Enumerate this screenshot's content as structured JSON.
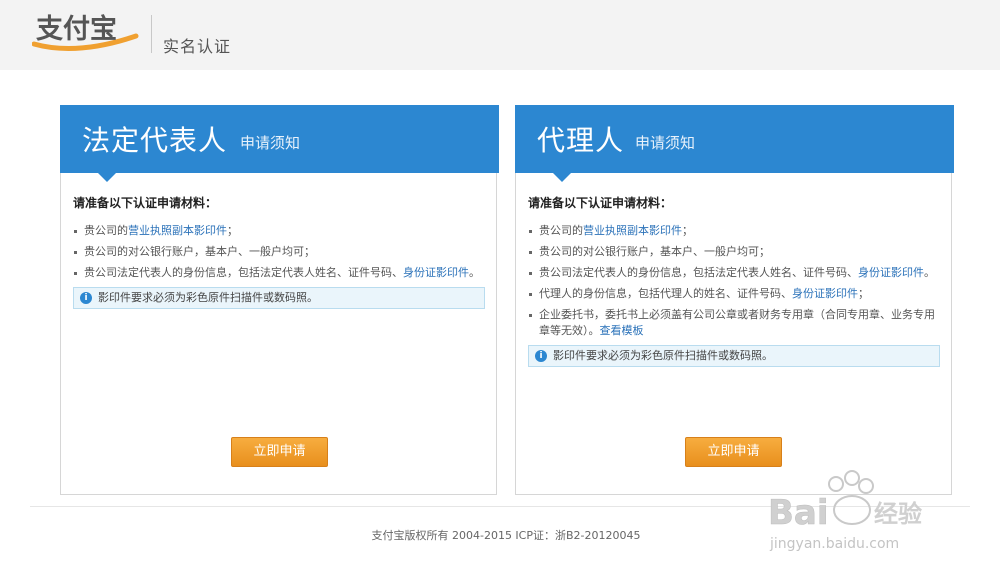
{
  "header": {
    "logo_text": "支付宝",
    "title": "实名认证"
  },
  "cards": [
    {
      "title": "法定代表人",
      "subtitle": "申请须知",
      "lead": "请准备以下认证申请材料：",
      "items": [
        {
          "text": "贵公司的",
          "link": "营业执照副本影印件",
          "tail": "；"
        },
        {
          "text": "贵公司的对公银行账户，基本户、一般户均可；",
          "link": "",
          "tail": ""
        },
        {
          "text": "贵公司法定代表人的身份信息，包括法定代表人姓名、证件号码、",
          "link": "身份证影印件",
          "tail": "。"
        }
      ],
      "notice": "影印件要求必须为彩色原件扫描件或数码照。",
      "button": "立即申请"
    },
    {
      "title": "代理人",
      "subtitle": "申请须知",
      "lead": "请准备以下认证申请材料：",
      "items": [
        {
          "text": "贵公司的",
          "link": "营业执照副本影印件",
          "tail": "；"
        },
        {
          "text": "贵公司的对公银行账户，基本户、一般户均可；",
          "link": "",
          "tail": ""
        },
        {
          "text": "贵公司法定代表人的身份信息，包括法定代表人姓名、证件号码、",
          "link": "身份证影印件",
          "tail": "。"
        },
        {
          "text": "代理人的身份信息，包括代理人的姓名、证件号码、",
          "link": "身份证影印件",
          "tail": "；"
        },
        {
          "text": "企业委托书，委托书上必须盖有公司公章或者财务专用章（合同专用章、业务专用章等无效）。",
          "link": "查看模板",
          "tail": ""
        }
      ],
      "notice": "影印件要求必须为彩色原件扫描件或数码照。",
      "button": "立即申请"
    }
  ],
  "footer": "支付宝版权所有 2004-2015 ICP证：浙B2-20120045",
  "watermark": {
    "brand": "Bai",
    "brand_cn": "经验",
    "url": "jingyan.baidu.com"
  },
  "colors": {
    "blue": "#2c87d1",
    "orange": "#f0a030",
    "link": "#2b72b9"
  }
}
